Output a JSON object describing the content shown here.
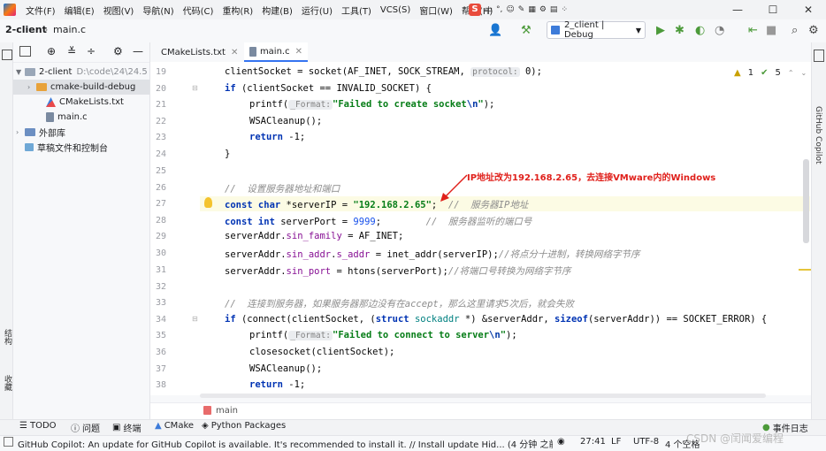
{
  "menu": [
    "文件(F)",
    "编辑(E)",
    "视图(V)",
    "导航(N)",
    "代码(C)",
    "重构(R)",
    "构建(B)",
    "运行(U)",
    "工具(T)",
    "VCS(S)",
    "窗口(W)",
    "帮助(H)"
  ],
  "ime": {
    "brand": "S",
    "items": [
      "中",
      "°,",
      "☺",
      "✎",
      "▦",
      "⚙",
      "▤",
      "⁘"
    ]
  },
  "window_controls": [
    "—",
    "☐",
    "✕"
  ],
  "toolbar": {
    "project_name": "2-client",
    "file_name": "main.c",
    "run_config": "2_client | Debug"
  },
  "project_panel": {
    "root": "2-client",
    "root_path": "D:\\code\\24\\24.5",
    "items": [
      "cmake-build-debug",
      "CMakeLists.txt",
      "main.c"
    ],
    "external": "外部库",
    "scratches": "草稿文件和控制台"
  },
  "tabs": [
    {
      "label": "CMakeLists.txt"
    },
    {
      "label": "main.c"
    }
  ],
  "inspections": {
    "warnings": "1",
    "ok": "5"
  },
  "annotation": "IP地址改为192.168.2.65，去连接VMware内的Windows",
  "lines": {
    "n19": "19",
    "n20": "20",
    "n21": "21",
    "n22": "22",
    "n23": "23",
    "n24": "24",
    "n25": "25",
    "n26": "26",
    "n27": "27",
    "n28": "28",
    "n29": "29",
    "n30": "30",
    "n31": "31",
    "n32": "32",
    "n33": "33",
    "n34": "34",
    "n35": "35",
    "n36": "36",
    "n37": "37",
    "n38": "38"
  },
  "code": {
    "l19a": "clientSocket = socket(AF_INET, SOCK_STREAM, ",
    "l19h": "protocol:",
    "l19b": " 0);",
    "l20a": "if",
    "l20b": " (clientSocket == INVALID_SOCKET) {",
    "l21a": "printf(",
    "l21h": "_Format:",
    "l21s": "\"Failed to create socket",
    "l21e": "\\n",
    "l21q": "\"",
    "l21b": ");",
    "l22": "WSACleanup();",
    "l23a": "return",
    "l23b": " -1;",
    "l24": "}",
    "l26": "//  设置服务器地址和端口",
    "l27k": "const char",
    "l27a": " *serverIP = ",
    "l27s": "\"192.168.2.65\"",
    "l27b": ";  ",
    "l27c": "//  服务器IP地址",
    "l28k": "const int",
    "l28a": " serverPort = ",
    "l28n": "9999",
    "l28b": ";        ",
    "l28c": "//  服务器监听的端口号",
    "l29a": "serverAddr.",
    "l29f": "sin_family",
    "l29b": " = AF_INET;",
    "l30a": "serverAddr.",
    "l30f": "sin_addr",
    "l30d": ".",
    "l30g": "s_addr",
    "l30b": " = inet_addr(serverIP);",
    "l30c": "//将点分十进制，转换网络字节序",
    "l31a": "serverAddr.",
    "l31f": "sin_port",
    "l31b": " = htons(serverPort);",
    "l31c": "//将端口号转换为网络字节序",
    "l33": "//  连接到服务器，如果服务器那边没有在accept，那么这里请求5次后，就会失败",
    "l34a": "if",
    "l34b": " (connect(clientSocket, (",
    "l34k": "struct",
    "l34t": " sockaddr",
    "l34c": " *) &serverAddr, ",
    "l34s": "sizeof",
    "l34d": "(serverAddr)) == SOCKET_ERROR) {",
    "l35a": "printf(",
    "l35h": "_Format:",
    "l35s": "\"Failed to connect to server",
    "l35e": "\\n",
    "l35q": "\"",
    "l35b": ");",
    "l36": "closesocket(clientSocket);",
    "l37": "WSACleanup();",
    "l38a": "return",
    "l38b": " -1;"
  },
  "bottom_breadcrumb": "main",
  "bottom_tools": [
    "TODO",
    "问题",
    "终端",
    "CMake",
    "Python Packages"
  ],
  "event_log": "事件日志",
  "right_tool": "GitHub Copilot",
  "left_tools": [
    "结构",
    "收藏"
  ],
  "status": {
    "message": "GitHub Copilot: An update for GitHub Copilot is available. It's recommended to install it. // Install update   Hid... (4 分钟 之前)",
    "position": "27:41",
    "line_sep": "LF",
    "encoding": "UTF-8",
    "indent": "4 个空格"
  },
  "watermark": "CSDN @闰闻爱编程"
}
